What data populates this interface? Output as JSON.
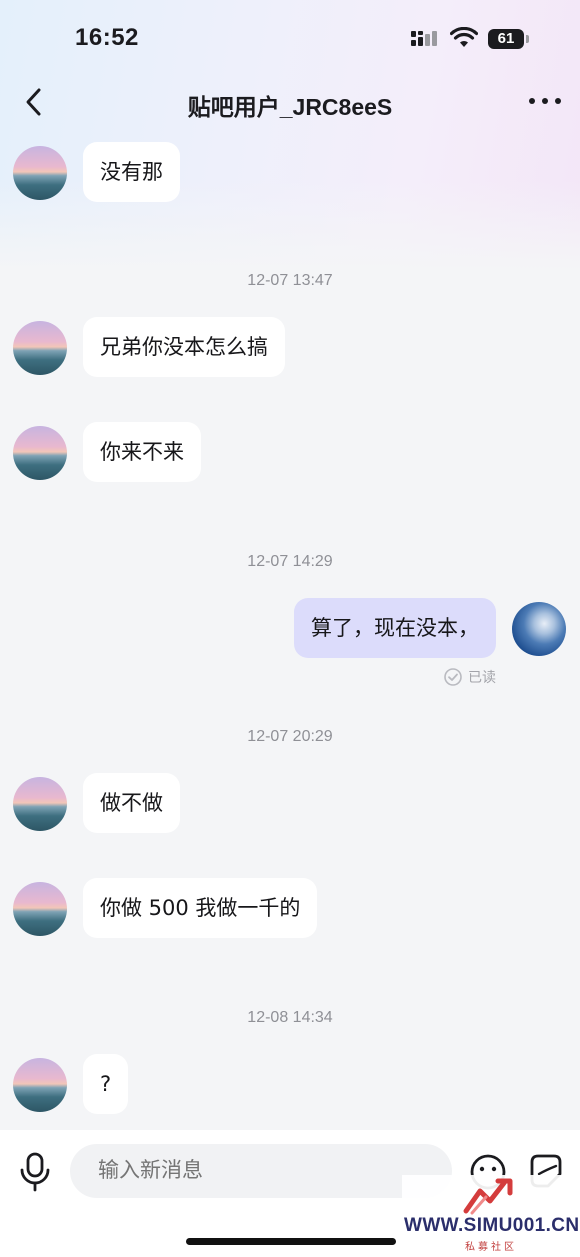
{
  "status_bar": {
    "time": "16:52",
    "battery": "61",
    "icons": [
      "signal-icon",
      "wifi-icon",
      "battery-icon"
    ]
  },
  "header": {
    "title": "贴吧用户_JRC8eeS",
    "back_icon": "chevron-left-icon",
    "more_icon": "more-dots-icon"
  },
  "messages": [
    {
      "side": "them",
      "text": "没有那"
    },
    {
      "type": "timestamp",
      "text": "12-07  13:47"
    },
    {
      "side": "them",
      "text": "兄弟你没本怎么搞"
    },
    {
      "side": "them",
      "text": "你来不来"
    },
    {
      "type": "timestamp",
      "text": "12-07  14:29"
    },
    {
      "side": "me",
      "text": "算了，现在没本，",
      "status": "已读"
    },
    {
      "type": "timestamp",
      "text": "12-07  20:29"
    },
    {
      "side": "them",
      "text": "做不做"
    },
    {
      "side": "them",
      "text": "你做 500 我做一千的"
    },
    {
      "type": "timestamp",
      "text": "12-08  14:34"
    },
    {
      "side": "them",
      "text": "?"
    }
  ],
  "composer": {
    "placeholder": "输入新消息",
    "icons": [
      "microphone-icon",
      "emoji-icon",
      "sticker-icon"
    ]
  },
  "watermark": {
    "text": "WWW.SIMU001.CN",
    "subtext": "私募社区"
  },
  "colors": {
    "background": "#f4f5f7",
    "bubble_them": "#ffffff",
    "bubble_me": "#dcdcfb",
    "timestamp": "#8f9096",
    "header_gradient_left": "#e4f0fb",
    "header_gradient_right": "#f3e6f7"
  }
}
